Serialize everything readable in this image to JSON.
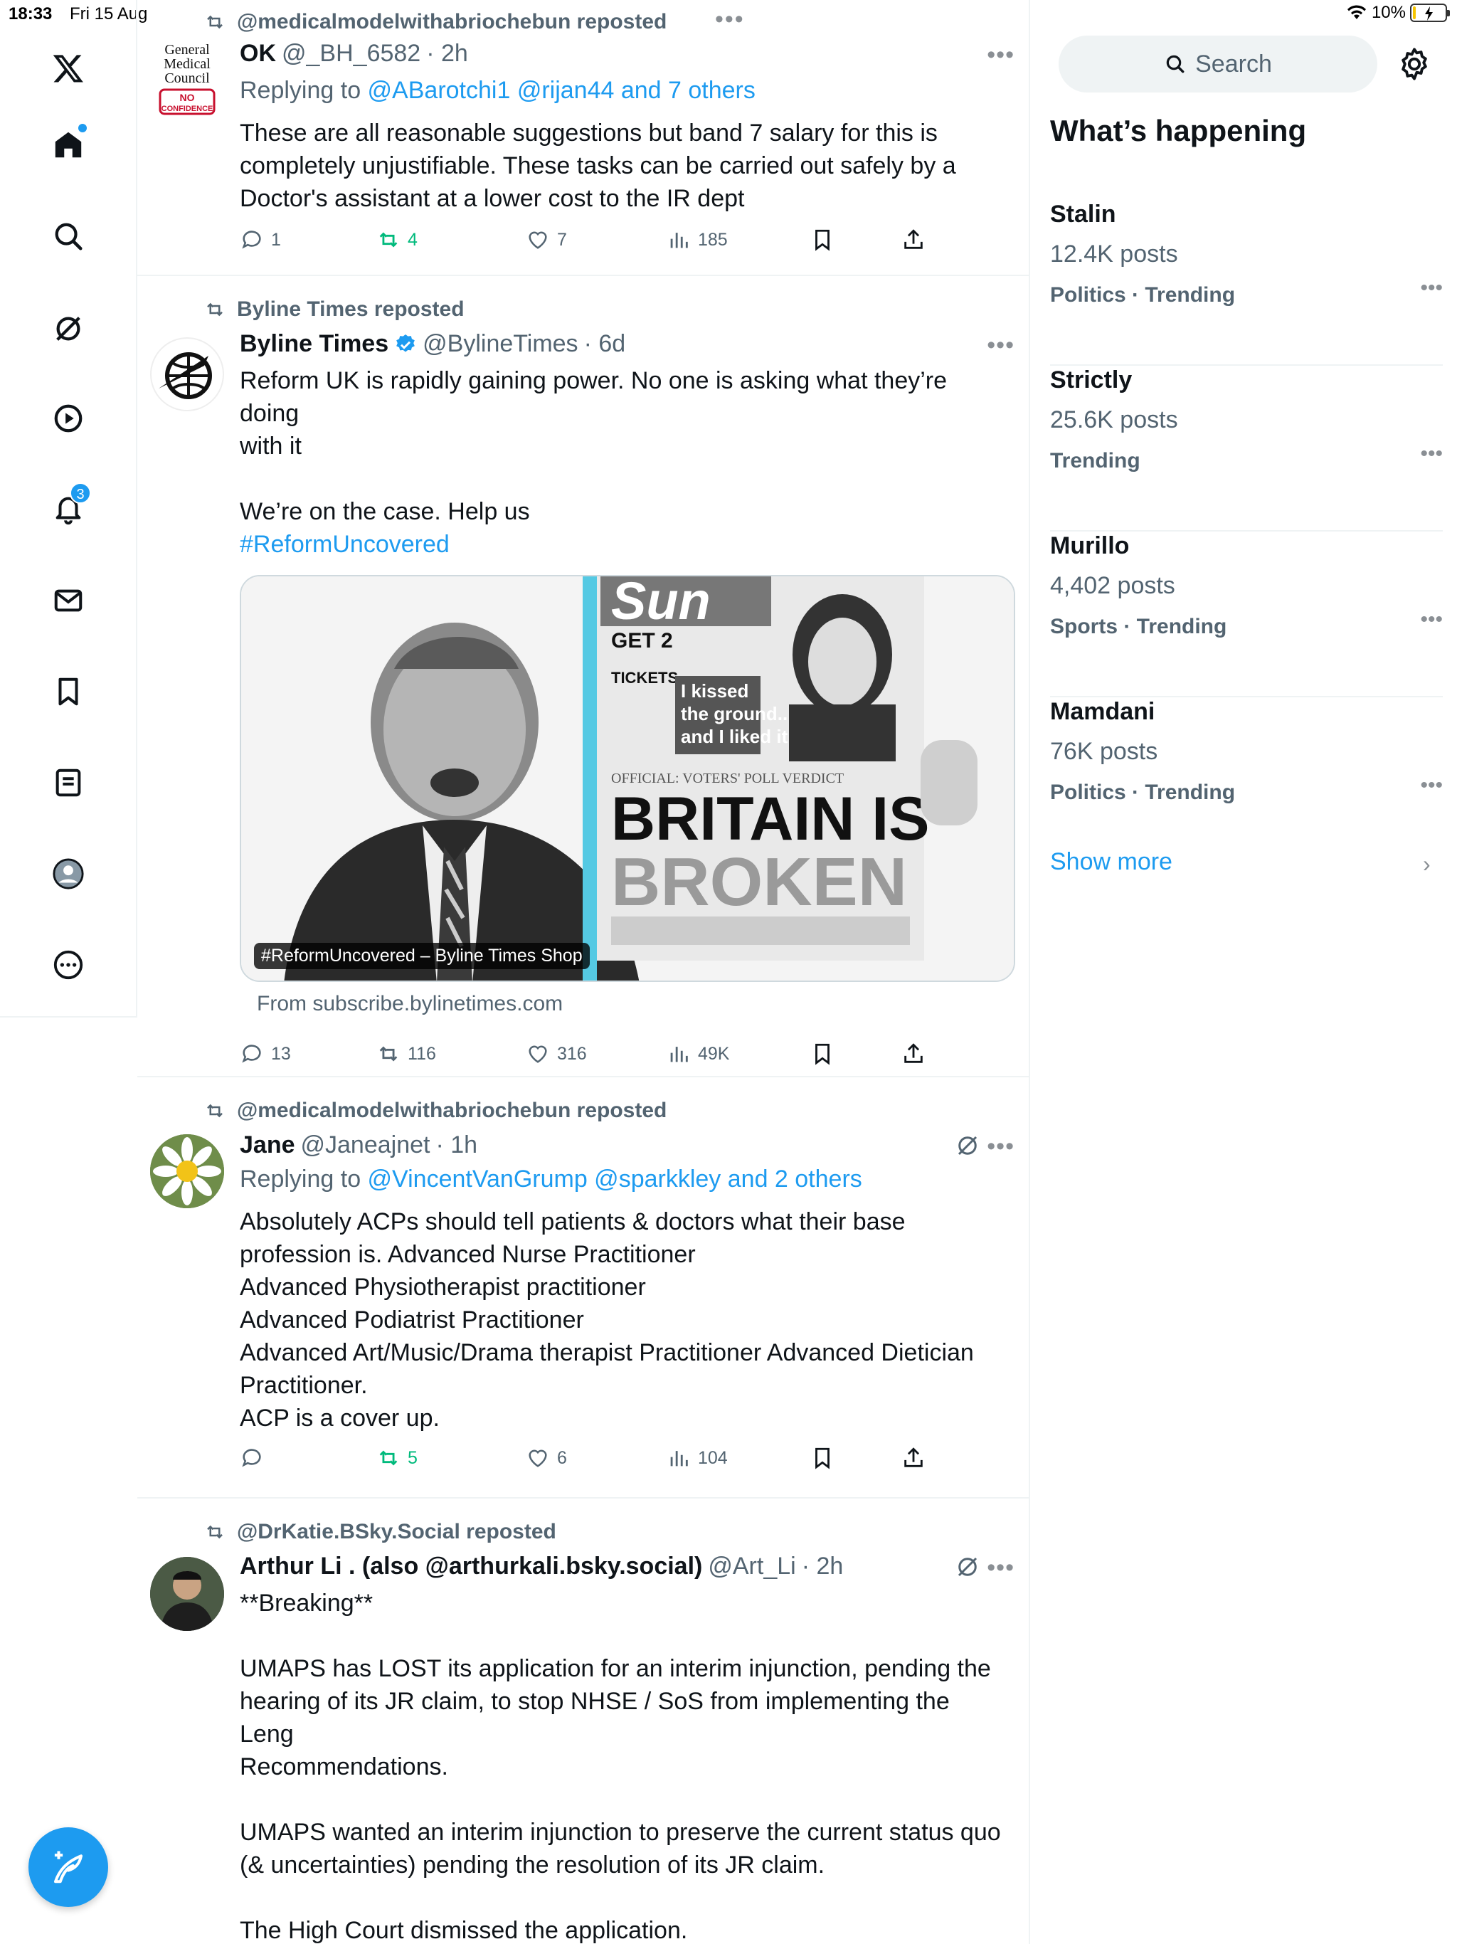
{
  "status": {
    "time": "18:33",
    "date": "Fri 15 Aug",
    "battery": "10%",
    "battery_level": 0.1
  },
  "nav": {
    "notifications_badge": "3"
  },
  "tweets": [
    {
      "repost_by": "@medicalmodelwithabriochebun reposted",
      "name": "OK",
      "handle": "@_BH_6582",
      "time": "· 2h",
      "reply_prefix": "Replying to ",
      "reply_to": "@ABarotchi1 @rijan44 and 7 others",
      "text": "These are all reasonable suggestions but band 7 salary for this is\ncompletely unjustifiable. These tasks can be carried out safely by a\nDoctor's assistant at a lower cost to the IR dept",
      "replies": "1",
      "reposts": "4",
      "likes": "7",
      "views": "185",
      "avatar_text": [
        "General",
        "Medical",
        "Council",
        "NO",
        "CONFIDENCE"
      ]
    },
    {
      "repost_by": "Byline Times reposted",
      "name": "Byline Times",
      "handle": "@BylineTimes",
      "time": "· 6d",
      "text": "Reform UK is rapidly gaining power. No one is asking what they’re doing\nwith it\n\nWe’re on the case. Help us",
      "hashtag": "#ReformUncovered",
      "card_label": "#ReformUncovered – Byline Times Shop",
      "card_from": "From subscribe.bylinetimes.com",
      "newspaper": {
        "masthead": "Sun",
        "get": "GET 2",
        "tickets": "TICKETS",
        "headline1": "BRITAIN IS",
        "headline2": "BROKEN",
        "kicker": "OFFICIAL: VOTERS' POLL VERDICT",
        "quote1": "I kissed",
        "quote2": "the ground...",
        "quote3": "and I liked it!"
      },
      "replies": "13",
      "reposts": "116",
      "likes": "316",
      "views": "49K"
    },
    {
      "repost_by": "@medicalmodelwithabriochebun reposted",
      "name": "Jane",
      "handle": "@Janeajnet",
      "time": "· 1h",
      "reply_prefix": "Replying to ",
      "reply_to": "@VincentVanGrump @sparkkley and 2 others",
      "text": "Absolutely ACPs should tell patients & doctors what their base\nprofession is. Advanced Nurse Practitioner\nAdvanced Physiotherapist practitioner\nAdvanced Podiatrist Practitioner\nAdvanced Art/Music/Drama therapist Practitioner Advanced Dietician\nPractitioner.\nACP is a cover up.",
      "replies": "",
      "reposts": "5",
      "likes": "6",
      "views": "104"
    },
    {
      "repost_by": "@DrKatie.BSky.Social reposted",
      "name": "Arthur Li . (also @arthurkali.bsky.social)",
      "handle": "@Art_Li",
      "time": "· 2h",
      "text": "**Breaking**\n\nUMAPS has LOST its application for an interim injunction, pending the\nhearing of its JR claim, to stop NHSE / SoS from implementing the Leng\nRecommendations.\n\nUMAPS wanted an interim injunction to preserve the current status quo\n(& uncertainties) pending the resolution of its JR claim.\n\nThe High Court dismissed the application."
    }
  ],
  "sidebar": {
    "search_label": "Search",
    "heading": "What’s happening",
    "trends": [
      {
        "title": "Stalin",
        "count": "12.4K posts",
        "meta": "Politics · Trending"
      },
      {
        "title": "Strictly",
        "count": "25.6K posts",
        "meta": "Trending"
      },
      {
        "title": "Murillo",
        "count": "4,402 posts",
        "meta": "Sports · Trending"
      },
      {
        "title": "Mamdani",
        "count": "76K posts",
        "meta": "Politics · Trending"
      }
    ],
    "show_more": "Show more"
  },
  "colors": {
    "accent": "#1d9bf0",
    "repost_active": "#00ba7c",
    "muted": "#536471"
  }
}
